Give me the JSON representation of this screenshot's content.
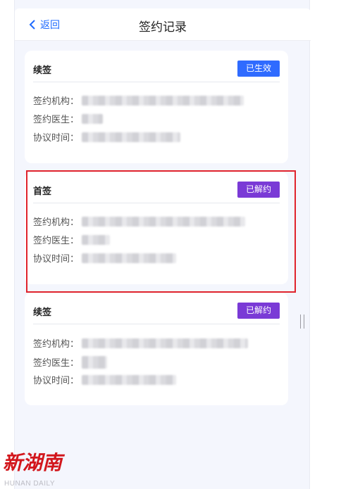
{
  "header": {
    "back_label": "返回",
    "title": "签约记录"
  },
  "labels": {
    "org": "签约机构：",
    "doctor": "签约医生：",
    "time": "协议时间："
  },
  "records": [
    {
      "type": "续签",
      "status": "已生效",
      "status_color": "#2f6bff"
    },
    {
      "type": "首签",
      "status": "已解约",
      "status_color": "#7a3ad6"
    },
    {
      "type": "续签",
      "status": "已解约",
      "status_color": "#7a3ad6"
    }
  ],
  "watermark": {
    "cn": "新湖南",
    "en": "HUNAN DAILY"
  },
  "colors": {
    "highlight_border": "#e0232c",
    "accent": "#1f6bff",
    "background": "#f4f6fd"
  }
}
